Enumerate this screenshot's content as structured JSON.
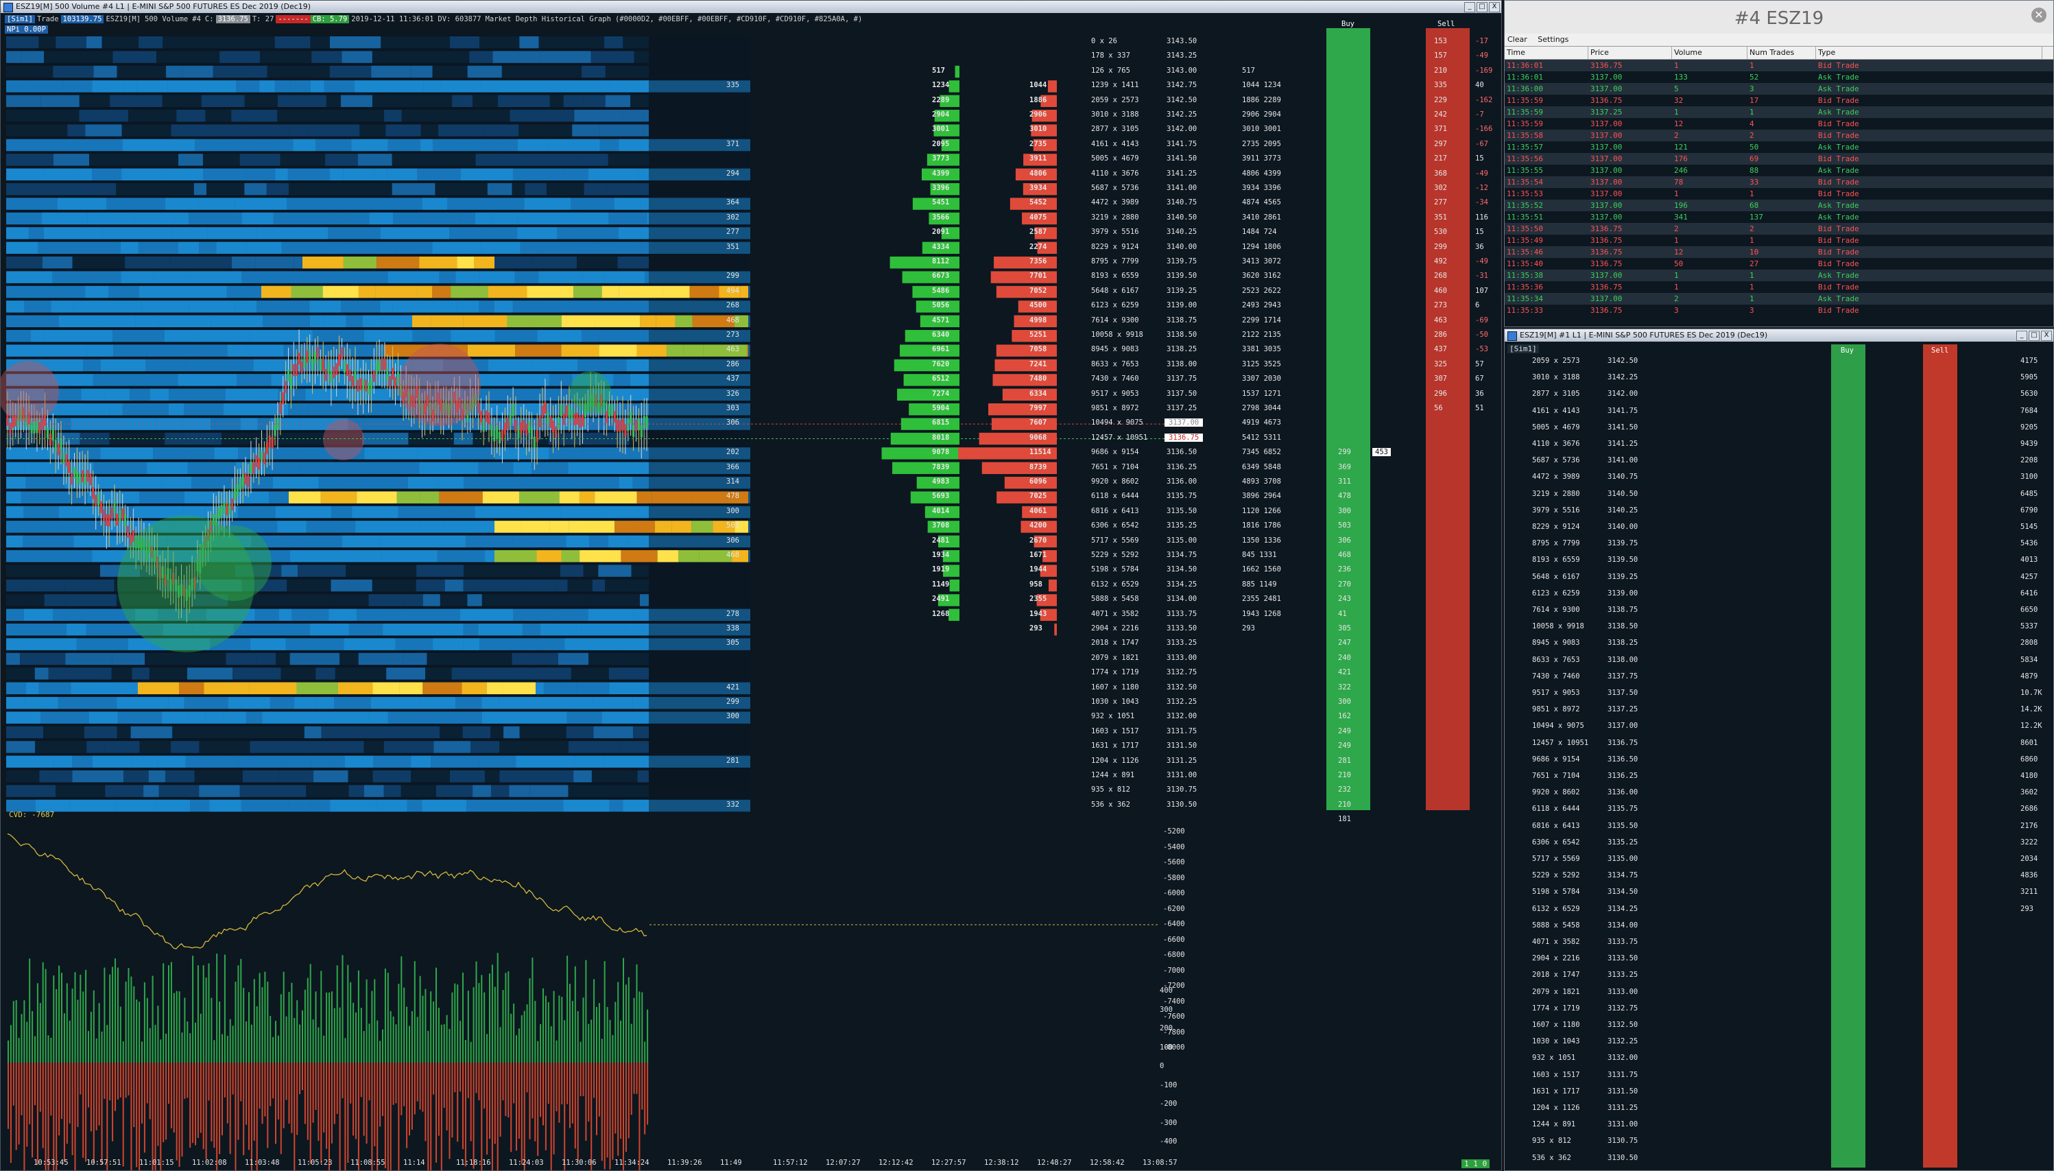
{
  "main_window": {
    "title": "ESZ19[M]  500 Volume  #4  L1  | E-MINI S&P 500 FUTURES ES Dec 2019 (Dec19)",
    "controls": [
      "_",
      "□",
      "X"
    ]
  },
  "info": {
    "line1": {
      "mode": "[Sim1]",
      "trade_label": "Trade",
      "trade_value": "103139.75",
      "symbol": "ESZ19[M]",
      "bars": "500 Volume",
      "num": "#4",
      "c_label": "C:",
      "c_value": "3136.75",
      "t_label": "T: 27",
      "red_box": "-------",
      "green_box": "CB: 5.79",
      "datetime": "2019-12-11  11:36:01",
      "dv": "DV: 603877",
      "study": "Market Depth Historical Graph",
      "colors": "(#0000D2, #00EBFF, #00EBFF, #CD910F, #CD910F, #825A0A, #)"
    },
    "line2": "NPi  0.00P"
  },
  "price_ladder": [
    "3143.50",
    "3143.25",
    "3143.00",
    "3142.75",
    "3142.50",
    "3142.25",
    "3142.00",
    "3141.75",
    "3141.50",
    "3141.25",
    "3141.00",
    "3140.75",
    "3140.50",
    "3140.25",
    "3140.00",
    "3139.75",
    "3139.50",
    "3139.25",
    "3139.00",
    "3138.75",
    "3138.50",
    "3138.25",
    "3138.00",
    "3137.75",
    "3137.50",
    "3137.25",
    "3137.00",
    "3136.75",
    "3136.50",
    "3136.25",
    "3136.00",
    "3135.75",
    "3135.50",
    "3135.25",
    "3135.00",
    "3134.75",
    "3134.50",
    "3134.25",
    "3134.00",
    "3133.75",
    "3133.50",
    "3133.25",
    "3133.00",
    "3132.75",
    "3132.50",
    "3132.25",
    "3132.00",
    "3131.75",
    "3131.50",
    "3131.25",
    "3131.00",
    "3130.75",
    "3130.50"
  ],
  "heat_labels": [
    {
      "row": 3,
      "text": "335"
    },
    {
      "row": 7,
      "text": "371"
    },
    {
      "row": 9,
      "text": "294"
    },
    {
      "row": 11,
      "text": "364"
    },
    {
      "row": 12,
      "text": "302"
    },
    {
      "row": 13,
      "text": "277"
    },
    {
      "row": 14,
      "text": "351"
    },
    {
      "row": 16,
      "text": "299"
    },
    {
      "row": 17,
      "text": "494"
    },
    {
      "row": 18,
      "text": "268"
    },
    {
      "row": 19,
      "text": "468"
    },
    {
      "row": 20,
      "text": "273"
    },
    {
      "row": 21,
      "text": "463"
    },
    {
      "row": 22,
      "text": "286"
    },
    {
      "row": 23,
      "text": "437"
    },
    {
      "row": 24,
      "text": "326"
    },
    {
      "row": 25,
      "text": "303"
    },
    {
      "row": 26,
      "text": "306"
    },
    {
      "row": 28,
      "text": "202"
    },
    {
      "row": 29,
      "text": "366"
    },
    {
      "row": 30,
      "text": "314"
    },
    {
      "row": 31,
      "text": "478"
    },
    {
      "row": 32,
      "text": "300"
    },
    {
      "row": 33,
      "text": "503"
    },
    {
      "row": 34,
      "text": "306"
    },
    {
      "row": 35,
      "text": "468"
    },
    {
      "row": 39,
      "text": "278"
    },
    {
      "row": 40,
      "text": "338"
    },
    {
      "row": 41,
      "text": "305"
    },
    {
      "row": 44,
      "text": "421"
    },
    {
      "row": 45,
      "text": "299"
    },
    {
      "row": 46,
      "text": "300"
    },
    {
      "row": 49,
      "text": "281"
    },
    {
      "row": 52,
      "text": "332"
    }
  ],
  "bid_volume_profile": [
    "",
    "",
    "517",
    "1234",
    "2289",
    "2904",
    "3001",
    "2095",
    "3773",
    "4399",
    "3396",
    "5451",
    "3566",
    "2091",
    "4334",
    "8112",
    "6673",
    "5486",
    "5056",
    "4571",
    "6340",
    "6961",
    "7620",
    "6512",
    "7274",
    "5904",
    "6815",
    "8018",
    "9078",
    "7839",
    "4983",
    "5693",
    "4014",
    "3708",
    "2481",
    "1934",
    "1919",
    "1149",
    "2491",
    "1268"
  ],
  "ask_volume_profile": [
    "",
    "",
    "",
    "1044",
    "1886",
    "2906",
    "3010",
    "2735",
    "3911",
    "4806",
    "3934",
    "5452",
    "4075",
    "2587",
    "2274",
    "7356",
    "7701",
    "7052",
    "4500",
    "4998",
    "5251",
    "7058",
    "7241",
    "7480",
    "6334",
    "7997",
    "7607",
    "9068",
    "11514",
    "8739",
    "6096",
    "7025",
    "4061",
    "4200",
    "2670",
    "1671",
    "1944",
    "958",
    "2355",
    "1943",
    "293"
  ],
  "ladder_pairs": [
    "0 x 26",
    "178 x 337",
    "126 x 765",
    "1239 x 1411",
    "2059 x 2573",
    "3010 x 3188",
    "2877 x 3105",
    "4161 x 4143",
    "5005 x 4679",
    "4110 x 3676",
    "5687 x 5736",
    "4472 x 3989",
    "3219 x 2880",
    "3979 x 5516",
    "8229 x 9124",
    "8795 x 7799",
    "8193 x 6559",
    "5648 x 6167",
    "6123 x 6259",
    "7614 x 9300",
    "10058 x 9918",
    "8945 x 9083",
    "8633 x 7653",
    "7430 x 7460",
    "9517 x 9053",
    "9851 x 8972",
    "10494 x 9075",
    "12457 x 10951",
    "9686 x 9154",
    "7651 x 7104",
    "9920 x 8602",
    "6118 x 6444",
    "6816 x 6413",
    "6306 x 6542",
    "5717 x 5569",
    "5229 x 5292",
    "5198 x 5784",
    "6132 x 6529",
    "5888 x 5458",
    "4071 x 3582",
    "2904 x 2216",
    "2018 x 1747",
    "2079 x 1821",
    "1774 x 1719",
    "1607 x 1180",
    "1030 x 1043",
    "932 x 1051",
    "1603 x 1517",
    "1631 x 1717",
    "1204 x 1126",
    "1244 x 891",
    "935 x 812",
    "536 x 362"
  ],
  "dom_pairs": [
    "",
    "",
    "517",
    "1044 1234",
    "1886 2289",
    "2906 2904",
    "3010 3001",
    "2735 2095",
    "3911 3773",
    "4806 4399",
    "3934 3396",
    "4874 4565",
    "3410 2861",
    "1484 724",
    "1294 1806",
    "3413 3072",
    "3620 3162",
    "2523 2622",
    "2493 2943",
    "2299 1714",
    "2122 2135",
    "3381 3035",
    "3125 3525",
    "3307 2030",
    "1537 1271",
    "2798 3044",
    "4919 4673",
    "5412 5311",
    "7345 6852",
    "6349 5848",
    "4893 3708",
    "3896 2964",
    "1120 1266",
    "1816 1786",
    "1350 1336",
    "845 1331",
    "1662 1560",
    "885 1149",
    "2355 2481",
    "1943 1268",
    "293",
    ""
  ],
  "buy_col": [
    "",
    "",
    "",
    "",
    "",
    "",
    "",
    "",
    "",
    "",
    "",
    "",
    "",
    "",
    "",
    "",
    "",
    "",
    "",
    "",
    "",
    "",
    "",
    "",
    "",
    "",
    "",
    "",
    "299",
    "369",
    "311",
    "478",
    "300",
    "503",
    "306",
    "468",
    "236",
    "270",
    "243",
    "41",
    "305",
    "247",
    "240",
    "421",
    "322",
    "300",
    "162",
    "249",
    "249",
    "281",
    "210",
    "232",
    "210",
    "181"
  ],
  "sell_col": [
    "153",
    "157",
    "210",
    "335",
    "229",
    "242",
    "371",
    "297",
    "217",
    "368",
    "302",
    "277",
    "351",
    "530",
    "299",
    "492",
    "268",
    "460",
    "273",
    "463",
    "286",
    "437",
    "325",
    "307",
    "296",
    "56"
  ],
  "delta_col": [
    "-17",
    "-49",
    "-169",
    "40",
    "-162",
    "-7",
    "-166",
    "-67",
    "15",
    "-49",
    "-12",
    "-34",
    "116",
    "15",
    "36",
    "-49",
    "-31",
    "107",
    "6",
    "-69",
    "-50",
    "-53",
    "57",
    "67",
    "36",
    "51"
  ],
  "buy_header": "Buy",
  "sell_header": "Sell",
  "last_price_tag": {
    "bid": "3137.00",
    "ask": "3136.75",
    "bid_size": "453"
  },
  "cvd": {
    "label": "CVD: -7687",
    "ticks": [
      "-5200",
      "-5400",
      "-5600",
      "-5800",
      "-6000",
      "-6200",
      "-6400",
      "-6600",
      "-6800",
      "-7000",
      "-7200",
      "-7400",
      "-7600",
      "-7800",
      "-8000"
    ]
  },
  "volume_ticks": [
    "400",
    "300",
    "200",
    "100",
    "0",
    "-100",
    "-200",
    "-300",
    "-400"
  ],
  "time_axis": [
    "10:53:45",
    "10:57:51",
    "11:01:15",
    "11:02:08",
    "11:03:48",
    "11:05:23",
    "11:08:55",
    "11:14",
    "11:18:16",
    "11:24:03",
    "11:30:06",
    "11:34:24",
    "11:39:26",
    "11:49",
    "11:57:12",
    "12:07:27",
    "12:12:42",
    "12:27:57",
    "12:38:12",
    "12:48:27",
    "12:58:42",
    "13:08:57"
  ],
  "status_badge": "1 1 0",
  "tsr": {
    "title": "#4 ESZ19",
    "menu": [
      "Clear",
      "Settings"
    ],
    "columns": [
      "Time",
      "Price",
      "Volume",
      "Num Trades",
      "Type"
    ],
    "rows": [
      [
        "11:36:01",
        "3136.75",
        "1",
        "1",
        "Bid Trade"
      ],
      [
        "11:36:01",
        "3137.00",
        "133",
        "52",
        "Ask Trade"
      ],
      [
        "11:36:00",
        "3137.00",
        "5",
        "3",
        "Ask Trade"
      ],
      [
        "11:35:59",
        "3136.75",
        "32",
        "17",
        "Bid Trade"
      ],
      [
        "11:35:59",
        "3137.25",
        "1",
        "1",
        "Ask Trade"
      ],
      [
        "11:35:59",
        "3137.00",
        "12",
        "4",
        "Bid Trade"
      ],
      [
        "11:35:58",
        "3137.00",
        "2",
        "2",
        "Bid Trade"
      ],
      [
        "11:35:57",
        "3137.00",
        "121",
        "50",
        "Ask Trade"
      ],
      [
        "11:35:56",
        "3137.00",
        "176",
        "69",
        "Bid Trade"
      ],
      [
        "11:35:55",
        "3137.00",
        "246",
        "88",
        "Ask Trade"
      ],
      [
        "11:35:54",
        "3137.00",
        "78",
        "33",
        "Bid Trade"
      ],
      [
        "11:35:53",
        "3137.00",
        "1",
        "1",
        "Bid Trade"
      ],
      [
        "11:35:52",
        "3137.00",
        "196",
        "68",
        "Ask Trade"
      ],
      [
        "11:35:51",
        "3137.00",
        "341",
        "137",
        "Ask Trade"
      ],
      [
        "11:35:50",
        "3136.75",
        "2",
        "2",
        "Bid Trade"
      ],
      [
        "11:35:49",
        "3136.75",
        "1",
        "1",
        "Bid Trade"
      ],
      [
        "11:35:46",
        "3136.75",
        "12",
        "10",
        "Bid Trade"
      ],
      [
        "11:35:40",
        "3136.75",
        "50",
        "27",
        "Bid Trade"
      ],
      [
        "11:35:38",
        "3137.00",
        "1",
        "1",
        "Ask Trade"
      ],
      [
        "11:35:36",
        "3136.75",
        "1",
        "1",
        "Bid Trade"
      ],
      [
        "11:35:34",
        "3137.00",
        "2",
        "1",
        "Ask Trade"
      ],
      [
        "11:35:33",
        "3136.75",
        "3",
        "3",
        "Bid Trade"
      ]
    ]
  },
  "dom2": {
    "title": "ESZ19[M]  #1  L1 | E-MINI S&P 500 FUTURES ES Dec 2019 (Dec19)",
    "header_left": "[Sim1]",
    "buy_header": "Buy",
    "sell_header": "Sell",
    "prices": [
      "3142.50",
      "3142.25",
      "3142.00",
      "3141.75",
      "3141.50",
      "3141.25",
      "3141.00",
      "3140.75",
      "3140.50",
      "3140.25",
      "3140.00",
      "3139.75",
      "3139.50",
      "3139.25",
      "3139.00",
      "3138.75",
      "3138.50",
      "3138.25",
      "3138.00",
      "3137.75",
      "3137.50",
      "3137.25",
      "3137.00",
      "3136.75",
      "3136.50",
      "3136.25",
      "3136.00",
      "3135.75",
      "3135.50",
      "3135.25",
      "3135.00",
      "3134.75",
      "3134.50",
      "3134.25",
      "3134.00",
      "3133.75",
      "3133.50",
      "3133.25",
      "3133.00",
      "3132.75",
      "3132.50",
      "3132.25",
      "3132.00",
      "3131.75",
      "3131.50",
      "3131.25",
      "3131.00",
      "3130.75",
      "3130.50"
    ],
    "pairs": [
      "2059 x 2573",
      "3010 x 3188",
      "2877 x 3105",
      "4161 x 4143",
      "5005 x 4679",
      "4110 x 3676",
      "5687 x 5736",
      "4472 x 3989",
      "3219 x 2880",
      "3979 x 5516",
      "8229 x 9124",
      "8795 x 7799",
      "8193 x 6559",
      "5648 x 6167",
      "6123 x 6259",
      "7614 x 9300",
      "10058 x 9918",
      "8945 x 9083",
      "8633 x 7653",
      "7430 x 7460",
      "9517 x 9053",
      "9851 x 8972",
      "10494 x 9075",
      "12457 x 10951",
      "9686 x 9154",
      "7651 x 7104",
      "9920 x 8602",
      "6118 x 6444",
      "6816 x 6413",
      "6306 x 6542",
      "5717 x 5569",
      "5229 x 5292",
      "5198 x 5784",
      "6132 x 6529",
      "5888 x 5458",
      "4071 x 3582",
      "2904 x 2216",
      "2018 x 1747",
      "2079 x 1821",
      "1774 x 1719",
      "1607 x 1180",
      "1030 x 1043",
      "932 x 1051",
      "1603 x 1517",
      "1631 x 1717",
      "1204 x 1126",
      "1244 x 891",
      "935 x 812",
      "536 x 362"
    ],
    "right_totals": [
      "4175",
      "5905",
      "5630",
      "7684",
      "9205",
      "9439",
      "2208",
      "3100",
      "6485",
      "6790",
      "5145",
      "5436",
      "4013",
      "4257",
      "6416",
      "6650",
      "5337",
      "2808",
      "5834",
      "4879",
      "10.7K",
      "14.2K",
      "12.2K",
      "8601",
      "6860",
      "4180",
      "3602",
      "2686",
      "2176",
      "3222",
      "2034",
      "4836",
      "3211",
      "293"
    ]
  }
}
